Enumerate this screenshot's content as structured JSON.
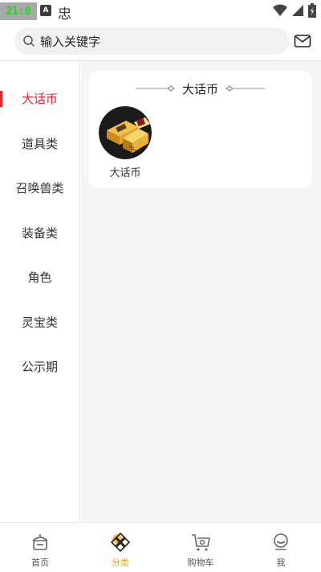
{
  "status_bar": {
    "time": "21:0",
    "notification_badge": "A",
    "app_glyph": "忠"
  },
  "search": {
    "placeholder": "输入关键字"
  },
  "sidebar": {
    "items": [
      {
        "label": "大话币",
        "active": true
      },
      {
        "label": "道具类",
        "active": false
      },
      {
        "label": "召唤兽类",
        "active": false
      },
      {
        "label": "装备类",
        "active": false
      },
      {
        "label": "角色",
        "active": false
      },
      {
        "label": "灵宝类",
        "active": false
      },
      {
        "label": "公示期",
        "active": false
      }
    ]
  },
  "content": {
    "section_title": "大话币",
    "items": [
      {
        "label": "大话币",
        "image": "gold-coin-stack-image"
      }
    ]
  },
  "bottom_nav": {
    "items": [
      {
        "label": "首页",
        "icon": "home-icon"
      },
      {
        "label": "分类",
        "icon": "category-icon",
        "active": true
      },
      {
        "label": "购物车",
        "icon": "cart-icon"
      },
      {
        "label": "我",
        "icon": "profile-icon"
      }
    ]
  },
  "colors": {
    "accent_red": "#e0282e",
    "accent_orange": "#f2a21b",
    "content_bg": "#f5f5f5"
  }
}
